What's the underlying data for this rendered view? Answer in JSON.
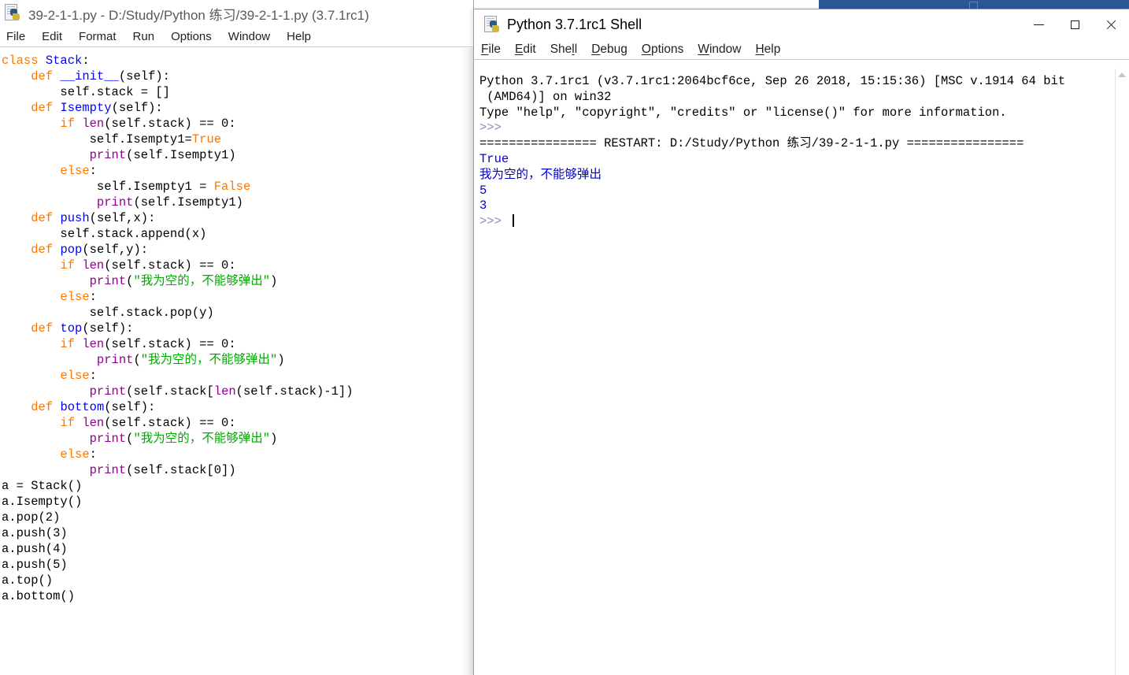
{
  "background_window": {
    "name": "partially-hidden-window",
    "color": "#2b5797",
    "ghost_text": ""
  },
  "editor_window": {
    "icon": "python-file-icon",
    "title": "39-2-1-1.py - D:/Study/Python 练习/39-2-1-1.py (3.7.1rc1)",
    "menu": [
      {
        "label": "File"
      },
      {
        "label": "Edit"
      },
      {
        "label": "Format"
      },
      {
        "label": "Run"
      },
      {
        "label": "Options"
      },
      {
        "label": "Window"
      },
      {
        "label": "Help"
      }
    ],
    "code_lines": [
      [
        {
          "t": "class ",
          "c": "kw"
        },
        {
          "t": "Stack",
          "c": "def"
        },
        {
          "t": ":",
          "c": ""
        }
      ],
      [
        {
          "t": "    ",
          "c": ""
        },
        {
          "t": "def ",
          "c": "kw"
        },
        {
          "t": "__init__",
          "c": "def"
        },
        {
          "t": "(self):",
          "c": ""
        }
      ],
      [
        {
          "t": "        self.stack = []",
          "c": ""
        }
      ],
      [
        {
          "t": "    ",
          "c": ""
        },
        {
          "t": "def ",
          "c": "kw"
        },
        {
          "t": "Isempty",
          "c": "def"
        },
        {
          "t": "(self):",
          "c": ""
        }
      ],
      [
        {
          "t": "        ",
          "c": ""
        },
        {
          "t": "if ",
          "c": "kw"
        },
        {
          "t": "len",
          "c": "bi"
        },
        {
          "t": "(self.stack) == 0:",
          "c": ""
        }
      ],
      [
        {
          "t": "            self.Isempty1=",
          "c": ""
        },
        {
          "t": "True",
          "c": "bi2"
        }
      ],
      [
        {
          "t": "            ",
          "c": ""
        },
        {
          "t": "print",
          "c": "bi"
        },
        {
          "t": "(self.Isempty1)",
          "c": ""
        }
      ],
      [
        {
          "t": "        ",
          "c": ""
        },
        {
          "t": "else",
          "c": "kw"
        },
        {
          "t": ":",
          "c": ""
        }
      ],
      [
        {
          "t": "             self.Isempty1 = ",
          "c": ""
        },
        {
          "t": "False",
          "c": "bi2"
        }
      ],
      [
        {
          "t": "             ",
          "c": ""
        },
        {
          "t": "print",
          "c": "bi"
        },
        {
          "t": "(self.Isempty1)",
          "c": ""
        }
      ],
      [
        {
          "t": "    ",
          "c": ""
        },
        {
          "t": "def ",
          "c": "kw"
        },
        {
          "t": "push",
          "c": "def"
        },
        {
          "t": "(self,x):",
          "c": ""
        }
      ],
      [
        {
          "t": "        self.stack.append(x)",
          "c": ""
        }
      ],
      [
        {
          "t": "    ",
          "c": ""
        },
        {
          "t": "def ",
          "c": "kw"
        },
        {
          "t": "pop",
          "c": "def"
        },
        {
          "t": "(self,y):",
          "c": ""
        }
      ],
      [
        {
          "t": "        ",
          "c": ""
        },
        {
          "t": "if ",
          "c": "kw"
        },
        {
          "t": "len",
          "c": "bi"
        },
        {
          "t": "(self.stack) == 0:",
          "c": ""
        }
      ],
      [
        {
          "t": "            ",
          "c": ""
        },
        {
          "t": "print",
          "c": "bi"
        },
        {
          "t": "(",
          "c": ""
        },
        {
          "t": "\"我为空的，不能够弹出\"",
          "c": "str"
        },
        {
          "t": ")",
          "c": ""
        }
      ],
      [
        {
          "t": "        ",
          "c": ""
        },
        {
          "t": "else",
          "c": "kw"
        },
        {
          "t": ":",
          "c": ""
        }
      ],
      [
        {
          "t": "            self.stack.pop(y)",
          "c": ""
        }
      ],
      [
        {
          "t": "    ",
          "c": ""
        },
        {
          "t": "def ",
          "c": "kw"
        },
        {
          "t": "top",
          "c": "def"
        },
        {
          "t": "(self):",
          "c": ""
        }
      ],
      [
        {
          "t": "        ",
          "c": ""
        },
        {
          "t": "if ",
          "c": "kw"
        },
        {
          "t": "len",
          "c": "bi"
        },
        {
          "t": "(self.stack) == 0:",
          "c": ""
        }
      ],
      [
        {
          "t": "             ",
          "c": ""
        },
        {
          "t": "print",
          "c": "bi"
        },
        {
          "t": "(",
          "c": ""
        },
        {
          "t": "\"我为空的，不能够弹出\"",
          "c": "str"
        },
        {
          "t": ")",
          "c": ""
        }
      ],
      [
        {
          "t": "        ",
          "c": ""
        },
        {
          "t": "else",
          "c": "kw"
        },
        {
          "t": ":",
          "c": ""
        }
      ],
      [
        {
          "t": "            ",
          "c": ""
        },
        {
          "t": "print",
          "c": "bi"
        },
        {
          "t": "(self.stack[",
          "c": ""
        },
        {
          "t": "len",
          "c": "bi"
        },
        {
          "t": "(self.stack)-1])",
          "c": ""
        }
      ],
      [
        {
          "t": "    ",
          "c": ""
        },
        {
          "t": "def ",
          "c": "kw"
        },
        {
          "t": "bottom",
          "c": "def"
        },
        {
          "t": "(self):",
          "c": ""
        }
      ],
      [
        {
          "t": "        ",
          "c": ""
        },
        {
          "t": "if ",
          "c": "kw"
        },
        {
          "t": "len",
          "c": "bi"
        },
        {
          "t": "(self.stack) == 0:",
          "c": ""
        }
      ],
      [
        {
          "t": "            ",
          "c": ""
        },
        {
          "t": "print",
          "c": "bi"
        },
        {
          "t": "(",
          "c": ""
        },
        {
          "t": "\"我为空的，不能够弹出\"",
          "c": "str"
        },
        {
          "t": ")",
          "c": ""
        }
      ],
      [
        {
          "t": "        ",
          "c": ""
        },
        {
          "t": "else",
          "c": "kw"
        },
        {
          "t": ":",
          "c": ""
        }
      ],
      [
        {
          "t": "            ",
          "c": ""
        },
        {
          "t": "print",
          "c": "bi"
        },
        {
          "t": "(self.stack[0])",
          "c": ""
        }
      ],
      [
        {
          "t": "a = Stack()",
          "c": ""
        }
      ],
      [
        {
          "t": "a.Isempty()",
          "c": ""
        }
      ],
      [
        {
          "t": "a.pop(2)",
          "c": ""
        }
      ],
      [
        {
          "t": "a.push(3)",
          "c": ""
        }
      ],
      [
        {
          "t": "a.push(4)",
          "c": ""
        }
      ],
      [
        {
          "t": "a.push(5)",
          "c": ""
        }
      ],
      [
        {
          "t": "a.top()",
          "c": ""
        }
      ],
      [
        {
          "t": "a.bottom()",
          "c": ""
        }
      ]
    ]
  },
  "shell_window": {
    "icon": "python-shell-icon",
    "title": "Python 3.7.1rc1 Shell",
    "menu": [
      {
        "label": "File",
        "mnemonic": "F"
      },
      {
        "label": "Edit",
        "mnemonic": "E"
      },
      {
        "label": "Shell",
        "mnemonic": "l"
      },
      {
        "label": "Debug",
        "mnemonic": "D"
      },
      {
        "label": "Options",
        "mnemonic": "O"
      },
      {
        "label": "Window",
        "mnemonic": "W"
      },
      {
        "label": "Help",
        "mnemonic": "H"
      }
    ],
    "window_controls": [
      {
        "name": "minimize-button",
        "glyph": "minimize-icon"
      },
      {
        "name": "maximize-button",
        "glyph": "maximize-icon"
      },
      {
        "name": "close-button",
        "glyph": "close-icon"
      }
    ],
    "output_lines": [
      [
        {
          "t": "Python 3.7.1rc1 (v3.7.1rc1:2064bcf6ce, Sep 26 2018, 15:15:36) [MSC v.1914 64 bit",
          "c": "restart"
        }
      ],
      [
        {
          "t": " (AMD64)] on win32",
          "c": "restart"
        }
      ],
      [
        {
          "t": "Type \"help\", \"copyright\", \"credits\" or \"license()\" for more information.",
          "c": "restart"
        }
      ],
      [
        {
          "t": ">>> ",
          "c": "prompt"
        }
      ],
      [
        {
          "t": "================ RESTART: D:/Study/Python 练习/39-2-1-1.py ================",
          "c": "restart"
        }
      ],
      [
        {
          "t": "True",
          "c": "out"
        }
      ],
      [
        {
          "t": "我为空的，不能够弹出",
          "c": "out"
        }
      ],
      [
        {
          "t": "5",
          "c": "out"
        }
      ],
      [
        {
          "t": "3",
          "c": "out"
        }
      ],
      [
        {
          "t": ">>> ",
          "c": "prompt",
          "caret": true
        }
      ]
    ],
    "scrollbar": {
      "name": "vertical-scrollbar",
      "arrow": "scroll-up-arrow"
    }
  },
  "colors": {
    "keyword": "#ff7700",
    "definition": "#0000ff",
    "builtin": "#900090",
    "string": "#00aa00",
    "shell_stdout": "#0000cc",
    "shell_prompt": "#9b84bb",
    "accent_window": "#2b5797"
  }
}
